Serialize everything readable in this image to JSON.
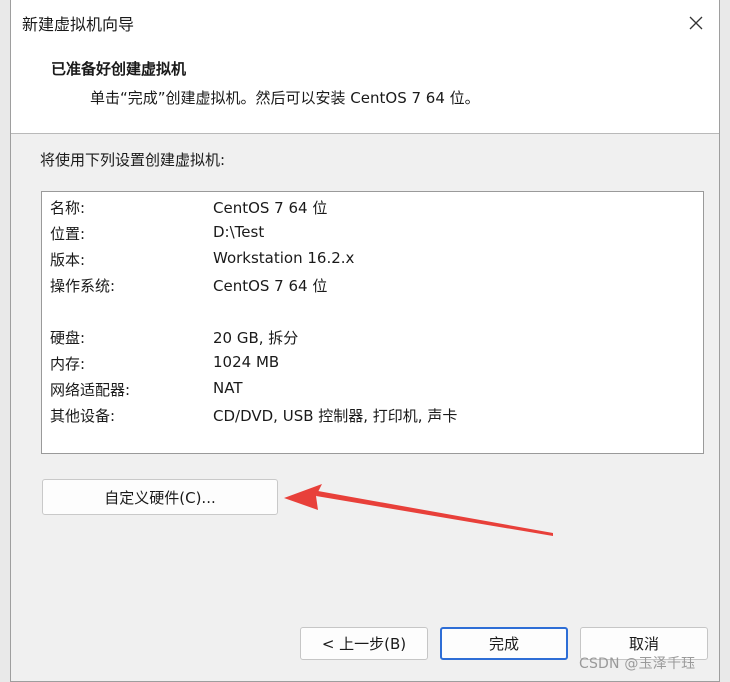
{
  "window": {
    "title": "新建虚拟机向导"
  },
  "header": {
    "title": "已准备好创建虚拟机",
    "subtitle": "单击“完成”创建虚拟机。然后可以安装 CentOS 7 64 位。"
  },
  "intro": "将使用下列设置创建虚拟机:",
  "summary": [
    {
      "key": "名称:",
      "value": "CentOS 7 64 位"
    },
    {
      "key": "位置:",
      "value": "D:\\Test"
    },
    {
      "key": "版本:",
      "value": "Workstation 16.2.x"
    },
    {
      "key": "操作系统:",
      "value": "CentOS 7 64 位"
    },
    {
      "key": "硬盘:",
      "value": "20 GB, 拆分"
    },
    {
      "key": "内存:",
      "value": "1024 MB"
    },
    {
      "key": "网络适配器:",
      "value": "NAT"
    },
    {
      "key": "其他设备:",
      "value": "CD/DVD, USB 控制器, 打印机, 声卡"
    }
  ],
  "buttons": {
    "customize": "自定义硬件(C)...",
    "back": "< 上一步(B)",
    "finish": "完成",
    "cancel": "取消"
  },
  "watermark": "CSDN @玉泽千珏",
  "colors": {
    "arrow": "#e8403a",
    "default_button_border": "#2e6ed6"
  }
}
